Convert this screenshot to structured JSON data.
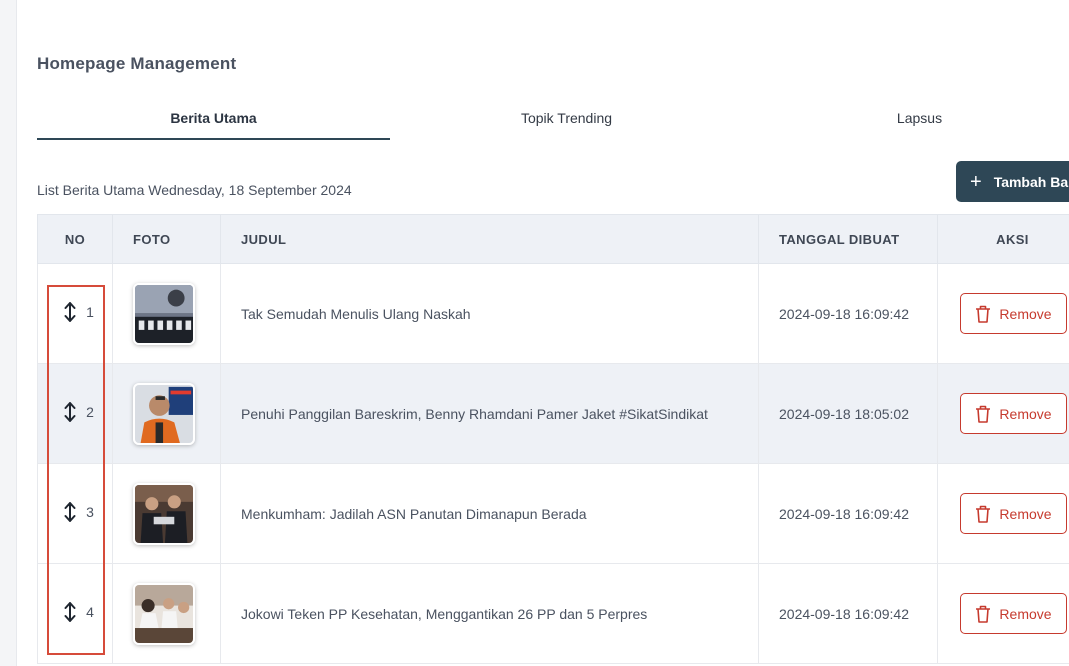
{
  "page": {
    "title": "Homepage Management"
  },
  "tabs": [
    {
      "label": "Berita Utama",
      "active": true
    },
    {
      "label": "Topik Trending",
      "active": false
    },
    {
      "label": "Lapsus",
      "active": false
    }
  ],
  "list": {
    "caption": "List Berita Utama Wednesday, 18 September 2024",
    "add_button_label": "Tambah Ba"
  },
  "table": {
    "headers": {
      "no": "NO",
      "foto": "FOTO",
      "judul": "JUDUL",
      "tanggal": "TANGGAL DIBUAT",
      "aksi": "AKSI"
    },
    "rows": [
      {
        "no": "1",
        "judul": "Tak Semudah Menulis Ulang Naskah",
        "tanggal": "2024-09-18 16:09:42",
        "action_label": "Remove"
      },
      {
        "no": "2",
        "judul": "Penuhi Panggilan Bareskrim, Benny Rhamdani Pamer Jaket #SikatSindikat",
        "tanggal": "2024-09-18 18:05:02",
        "action_label": "Remove"
      },
      {
        "no": "3",
        "judul": "Menkumham: Jadilah ASN Panutan Dimanapun Berada",
        "tanggal": "2024-09-18 16:09:42",
        "action_label": "Remove"
      },
      {
        "no": "4",
        "judul": "Jokowi Teken PP Kesehatan, Menggantikan 26 PP dan 5 Perpres",
        "tanggal": "2024-09-18 16:09:42",
        "action_label": "Remove"
      }
    ]
  },
  "icons": {
    "drag": "drag-handle-icon",
    "plus": "plus-icon",
    "trash": "trash-icon"
  },
  "colors": {
    "primary": "#2e4756",
    "danger": "#c63a2e",
    "header_bg": "#eef1f6",
    "highlight": "#d64b3a"
  }
}
